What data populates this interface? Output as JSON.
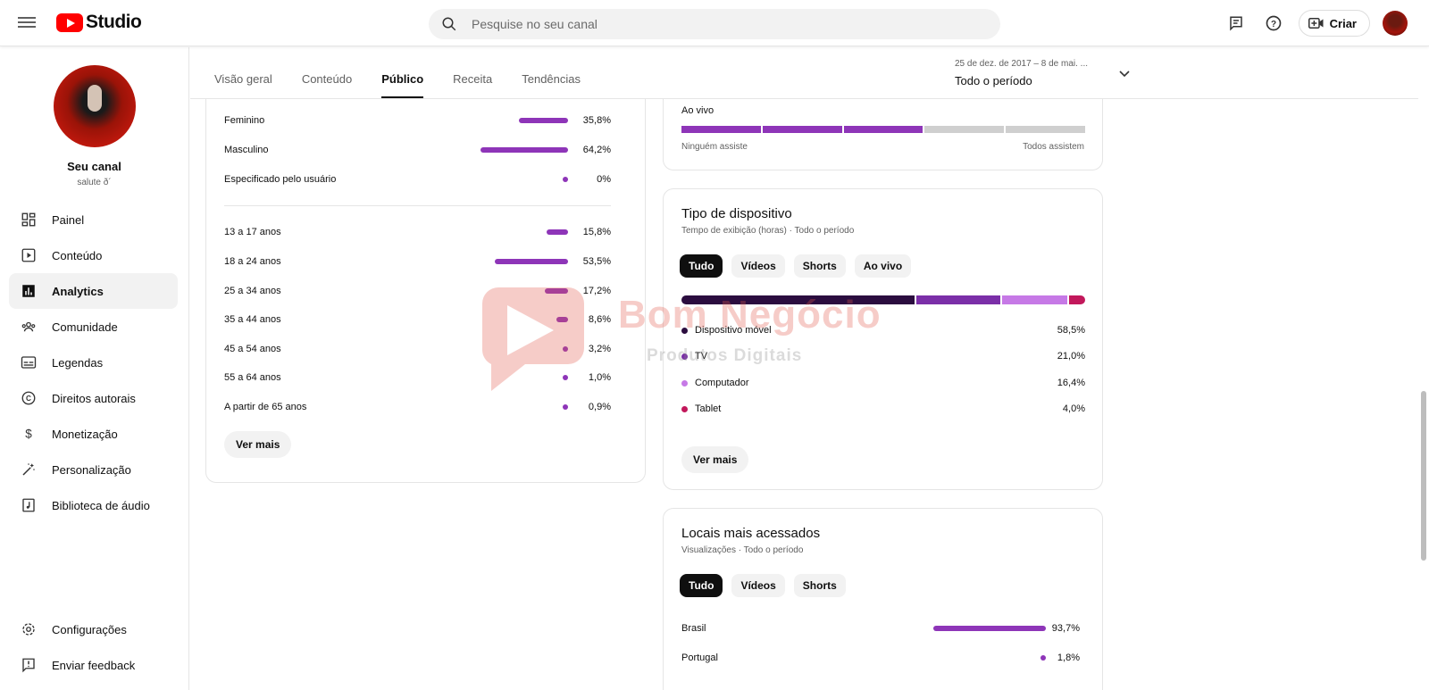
{
  "header": {
    "logo_text": "Studio",
    "search_placeholder": "Pesquise no seu canal",
    "create_label": "Criar"
  },
  "sidebar": {
    "channel_name": "Seu canal",
    "channel_handle": "salute ð´",
    "items": [
      {
        "label": "Painel",
        "icon": "dashboard-icon"
      },
      {
        "label": "Conteúdo",
        "icon": "content-icon"
      },
      {
        "label": "Analytics",
        "icon": "analytics-icon"
      },
      {
        "label": "Comunidade",
        "icon": "community-icon"
      },
      {
        "label": "Legendas",
        "icon": "subtitles-icon"
      },
      {
        "label": "Direitos autorais",
        "icon": "copyright-icon"
      },
      {
        "label": "Monetização",
        "icon": "monetization-icon"
      },
      {
        "label": "Personalização",
        "icon": "customization-icon"
      },
      {
        "label": "Biblioteca de áudio",
        "icon": "audio-library-icon"
      }
    ],
    "bottom_items": [
      {
        "label": "Configurações",
        "icon": "settings-icon"
      },
      {
        "label": "Enviar feedback",
        "icon": "feedback-icon"
      }
    ]
  },
  "tabs": [
    "Visão geral",
    "Conteúdo",
    "Público",
    "Receita",
    "Tendências"
  ],
  "active_tab": "Público",
  "period": {
    "range": "25 de dez. de 2017 – 8 de mai. ...",
    "label": "Todo o período"
  },
  "demographics": {
    "gender": [
      {
        "label": "Feminino",
        "value": "35,8%",
        "pct": 35.8
      },
      {
        "label": "Masculino",
        "value": "64,2%",
        "pct": 64.2
      },
      {
        "label": "Especificado pelo usuário",
        "value": "0%",
        "pct": 0
      }
    ],
    "age": [
      {
        "label": "13 a 17 anos",
        "value": "15,8%",
        "pct": 15.8
      },
      {
        "label": "18 a 24 anos",
        "value": "53,5%",
        "pct": 53.5
      },
      {
        "label": "25 a 34 anos",
        "value": "17,2%",
        "pct": 17.2
      },
      {
        "label": "35 a 44 anos",
        "value": "8,6%",
        "pct": 8.6
      },
      {
        "label": "45 a 54 anos",
        "value": "3,2%",
        "pct": 3.2
      },
      {
        "label": "55 a 64 anos",
        "value": "1,0%",
        "pct": 1.0
      },
      {
        "label": "A partir de 65 anos",
        "value": "0,9%",
        "pct": 0.9
      }
    ],
    "more_label": "Ver mais"
  },
  "live": {
    "label": "Ao vivo",
    "left_caption": "Ninguém assiste",
    "right_caption": "Todos assistem",
    "filled_segments": 3,
    "total_segments": 5
  },
  "device": {
    "title": "Tipo de dispositivo",
    "subtitle": "Tempo de exibição (horas) · Todo o período",
    "chips": [
      "Tudo",
      "Vídeos",
      "Shorts",
      "Ao vivo"
    ],
    "rows": [
      {
        "label": "Dispositivo móvel",
        "value": "58,5%",
        "pct": 58.5,
        "color": "#2b0d3f"
      },
      {
        "label": "TV",
        "value": "21,0%",
        "pct": 21.0,
        "color": "#7b2fa8"
      },
      {
        "label": "Computador",
        "value": "16,4%",
        "pct": 16.4,
        "color": "#c679e6"
      },
      {
        "label": "Tablet",
        "value": "4,0%",
        "pct": 4.0,
        "color": "#c2185b"
      }
    ],
    "more_label": "Ver mais"
  },
  "locations": {
    "title": "Locais mais acessados",
    "subtitle": "Visualizações · Todo o período",
    "chips": [
      "Tudo",
      "Vídeos",
      "Shorts"
    ],
    "rows": [
      {
        "label": "Brasil",
        "value": "93,7%",
        "pct": 93.7
      },
      {
        "label": "Portugal",
        "value": "1,8%",
        "pct": 1.8
      }
    ]
  },
  "watermark": {
    "title": "Bom Negócio",
    "subtitle": "Produtos Digitais"
  },
  "colors": {
    "accent_purple": "#8e35b8",
    "youtube_red": "#ff0000"
  }
}
